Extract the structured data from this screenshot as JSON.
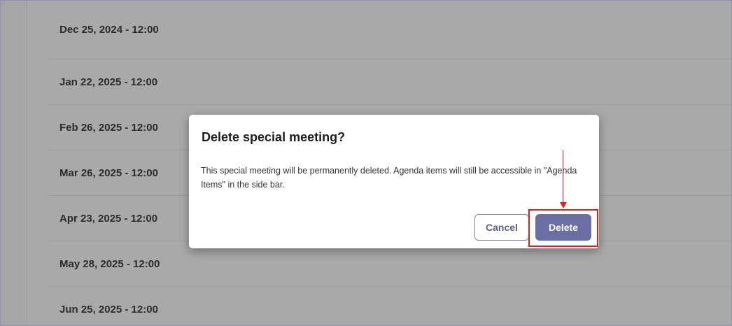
{
  "meetings": [
    {
      "label": "Dec 25, 2024 - 12:00"
    },
    {
      "label": "Jan 22, 2025 - 12:00"
    },
    {
      "label": "Feb 26, 2025 - 12:00"
    },
    {
      "label": "Mar 26, 2025 - 12:00"
    },
    {
      "label": "Apr 23, 2025 - 12:00"
    },
    {
      "label": "May 28, 2025 - 12:00"
    },
    {
      "label": "Jun 25, 2025 - 12:00"
    }
  ],
  "dialog": {
    "title": "Delete special meeting?",
    "body": "This special meeting will be permanently deleted. Agenda items will still be accessible in \"Agenda Items\" in the side bar.",
    "cancel_label": "Cancel",
    "delete_label": "Delete"
  },
  "colors": {
    "overlay": "#a9a9a9",
    "primary": "#6a6ea3",
    "annotation": "#e02020"
  }
}
